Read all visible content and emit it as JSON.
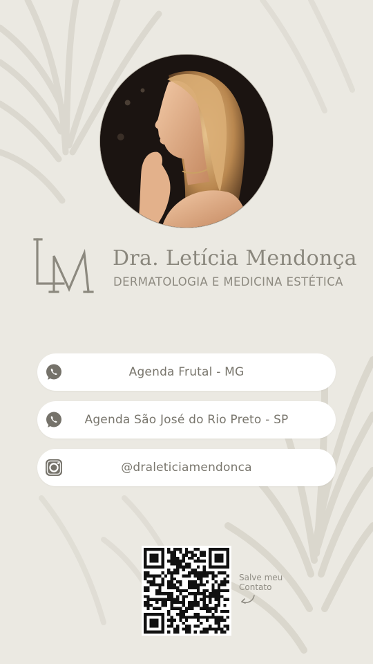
{
  "profile": {
    "name": "Dra. Letícia Mendonça",
    "specialty": "DERMATOLOGIA E MEDICINA ESTÉTICA",
    "monogram": "LM"
  },
  "links": [
    {
      "label": "Agenda Frutal - MG",
      "icon": "whatsapp-icon"
    },
    {
      "label": "Agenda São José do Rio Preto - SP",
      "icon": "whatsapp-icon"
    },
    {
      "label": "@draleticiamendonca",
      "icon": "instagram-icon"
    }
  ],
  "qr": {
    "caption_line1": "Salve meu",
    "caption_line2": "Contato"
  },
  "colors": {
    "background": "#ebe9e2",
    "button": "#ffffff",
    "text": "#79766d",
    "icon": "#75726a"
  }
}
